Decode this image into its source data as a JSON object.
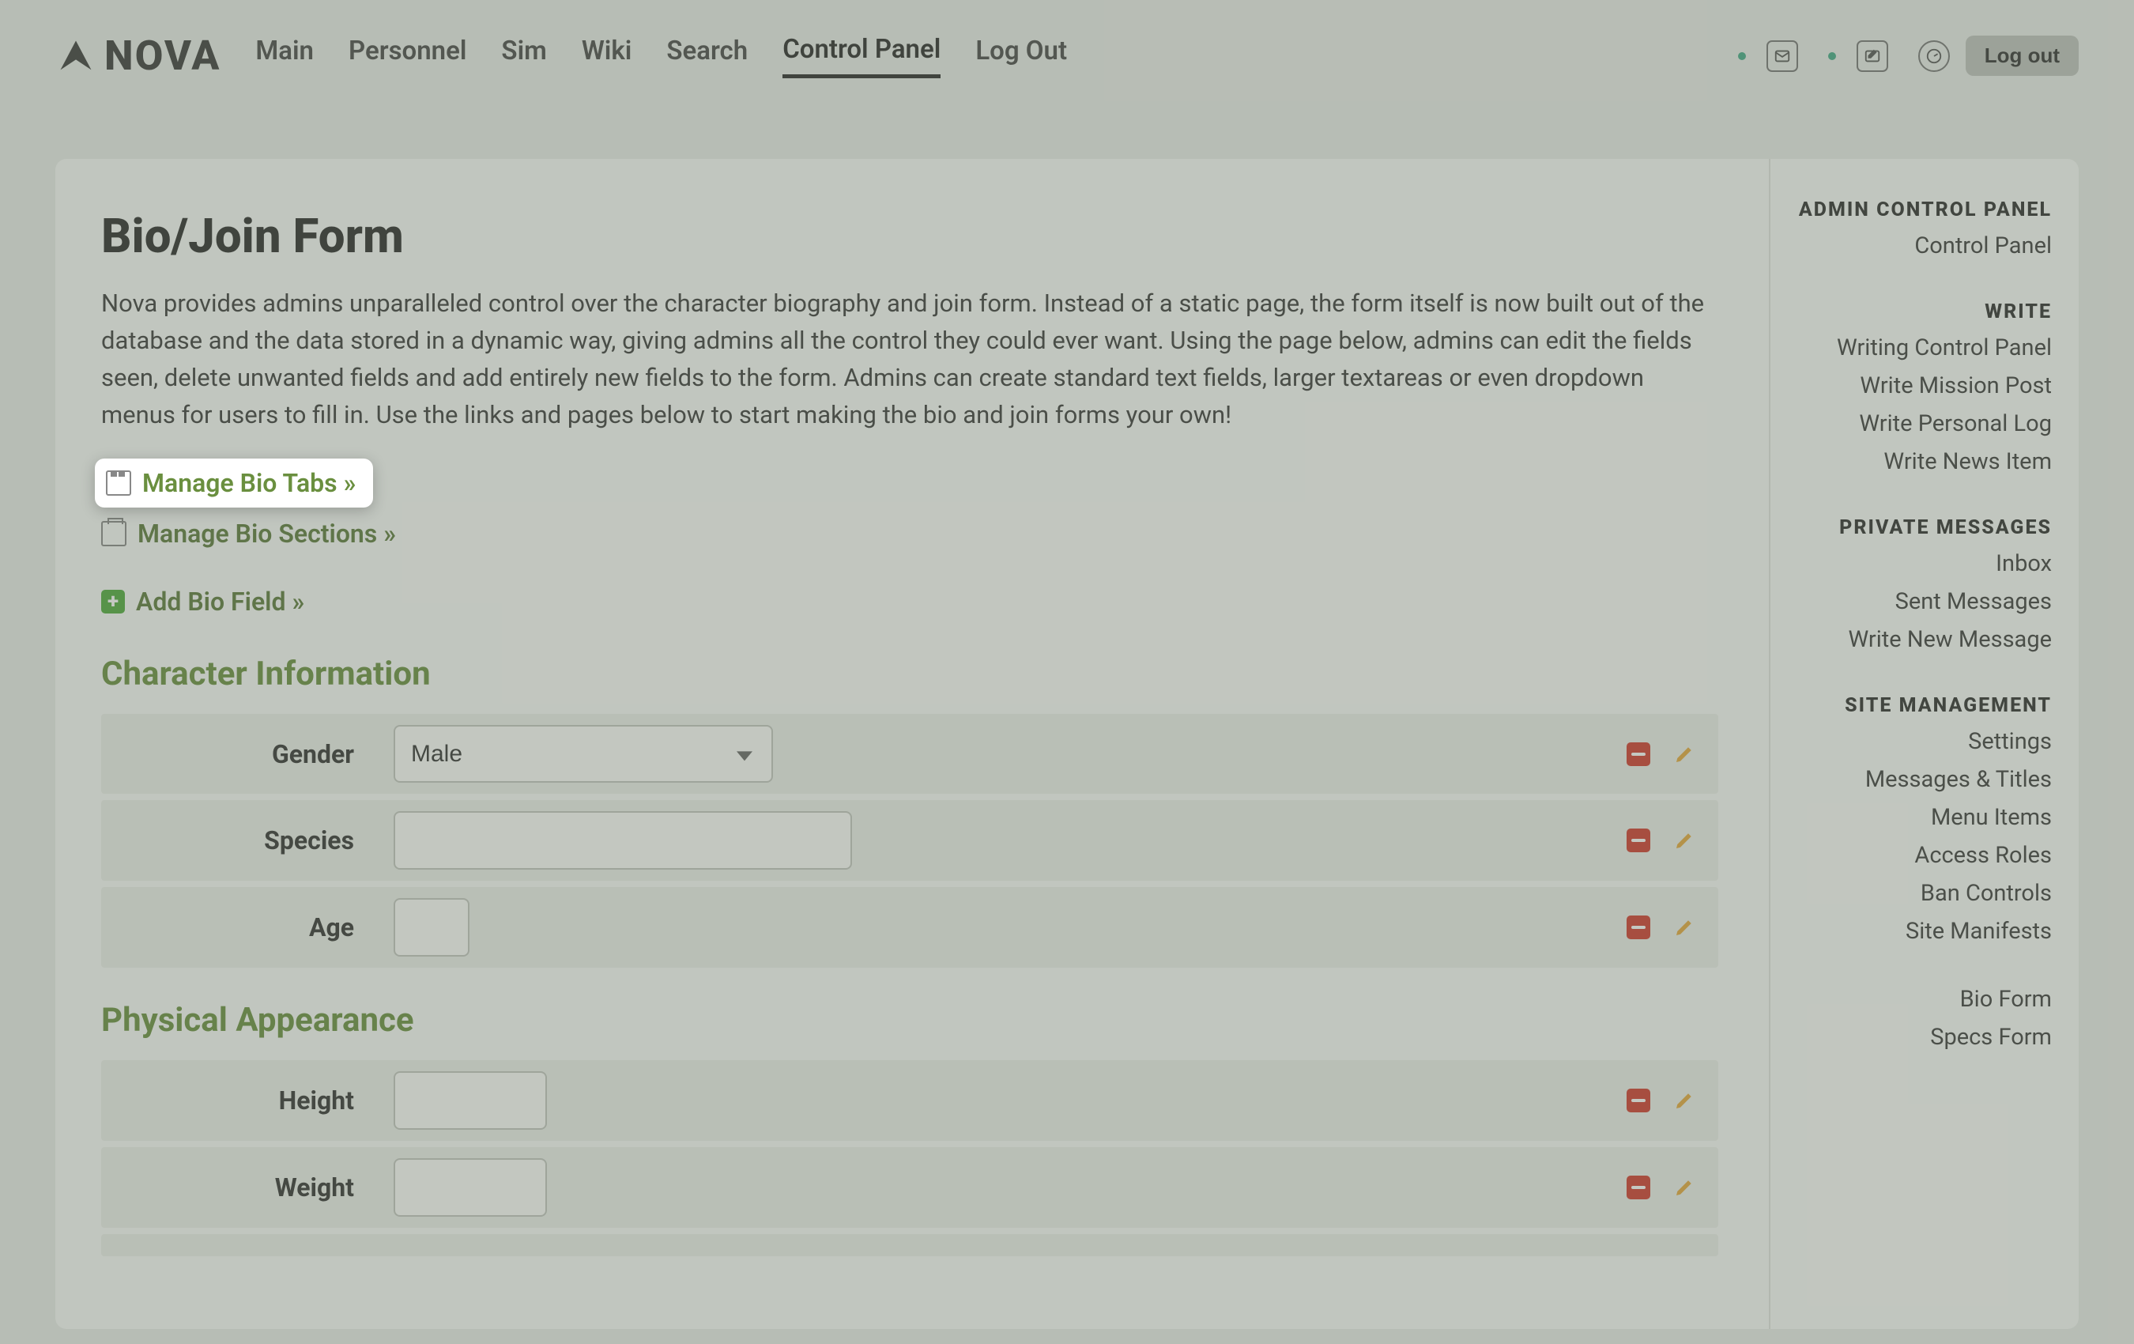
{
  "brand": "NOVA",
  "nav": [
    "Main",
    "Personnel",
    "Sim",
    "Wiki",
    "Search",
    "Control Panel",
    "Log Out"
  ],
  "nav_active": 5,
  "logout_btn": "Log out",
  "page": {
    "title": "Bio/Join Form",
    "intro": "Nova provides admins unparalleled control over the character biography and join form. Instead of a static page, the form itself is now built out of the database and the data stored in a dynamic way, giving admins all the control they could ever want. Using the page below, admins can edit the fields seen, delete unwanted fields and add entirely new fields to the form. Admins can create standard text fields, larger textareas or even dropdown menus for users to fill in. Use the links and pages below to start making the bio and join forms your own!",
    "link_tabs": "Manage Bio Tabs »",
    "link_sections": "Manage Bio Sections »",
    "link_add": "Add Bio Field »"
  },
  "sections": [
    {
      "title": "Character Information",
      "fields": [
        {
          "label": "Gender",
          "type": "select",
          "value": "Male",
          "width": "select"
        },
        {
          "label": "Species",
          "type": "text",
          "value": "",
          "width": "lg"
        },
        {
          "label": "Age",
          "type": "text",
          "value": "",
          "width": "sm"
        }
      ]
    },
    {
      "title": "Physical Appearance",
      "fields": [
        {
          "label": "Height",
          "type": "text",
          "value": "",
          "width": "md"
        },
        {
          "label": "Weight",
          "type": "text",
          "value": "",
          "width": "md"
        }
      ]
    }
  ],
  "sidebar": [
    {
      "title": "ADMIN CONTROL PANEL",
      "links": [
        "Control Panel"
      ]
    },
    {
      "title": "WRITE",
      "links": [
        "Writing Control Panel",
        "Write Mission Post",
        "Write Personal Log",
        "Write News Item"
      ]
    },
    {
      "title": "PRIVATE MESSAGES",
      "links": [
        "Inbox",
        "Sent Messages",
        "Write New Message"
      ]
    },
    {
      "title": "SITE MANAGEMENT",
      "links": [
        "Settings",
        "Messages & Titles",
        "Menu Items",
        "Access Roles",
        "Ban Controls",
        "Site Manifests"
      ]
    },
    {
      "title": "",
      "links": [
        "Bio Form",
        "Specs Form"
      ]
    }
  ]
}
